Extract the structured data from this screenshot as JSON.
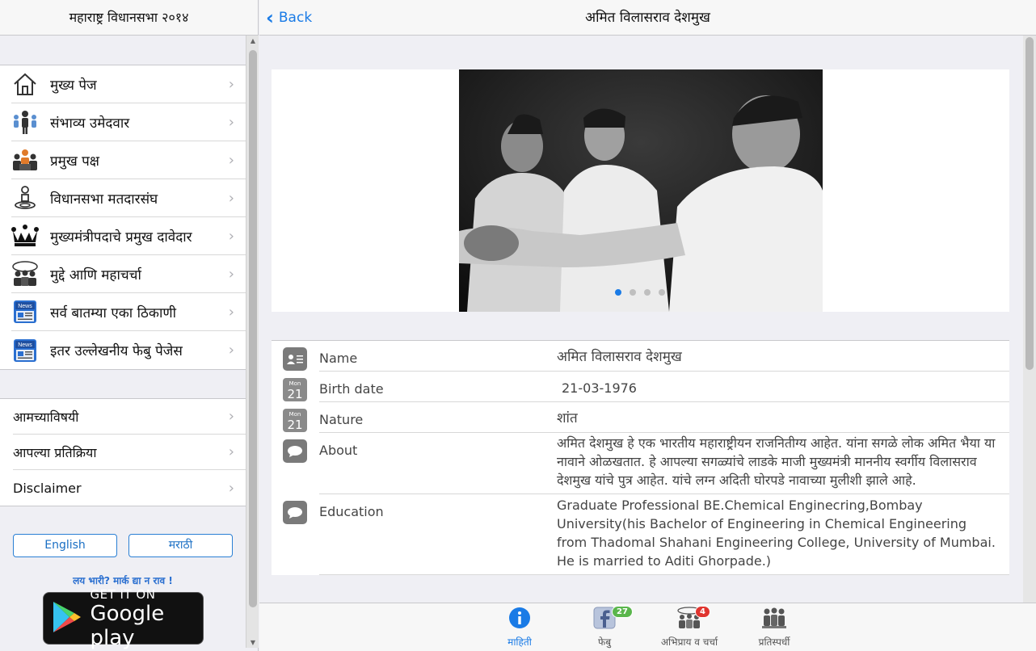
{
  "sidebar": {
    "title": "महाराष्ट्र विधानसभा २०१४",
    "items": [
      {
        "label": "मुख्य पेज",
        "icon": "home-icon"
      },
      {
        "label": "संभाव्य उमेदवार",
        "icon": "candidates-icon"
      },
      {
        "label": "प्रमुख पक्ष",
        "icon": "parties-icon"
      },
      {
        "label": "विधानसभा मतदारसंघ",
        "icon": "constituency-location-icon"
      },
      {
        "label": "मुख्यमंत्रीपदाचे प्रमुख दावेदार",
        "icon": "crown-icon"
      },
      {
        "label": "मुद्दे आणि महाचर्चा",
        "icon": "discussion-icon"
      },
      {
        "label": "सर्व बातम्या एका ठिकाणी",
        "icon": "news-icon"
      },
      {
        "label": "इतर उल्लेखनीय फेबु पेजेस",
        "icon": "news-icon"
      }
    ],
    "items2": [
      {
        "label": "आमच्याविषयी"
      },
      {
        "label": "आपल्या प्रतिक्रिया"
      },
      {
        "label": "Disclaimer"
      }
    ],
    "lang_english": "English",
    "lang_marathi": "मराठी",
    "tagline": "लय भारी? मार्क द्या न राव !",
    "gplay_line1": "GET IT ON",
    "gplay_line2": "Google play"
  },
  "topbar": {
    "back_label": "Back",
    "title": "अमित विलासराव देशमुख"
  },
  "gallery": {
    "total_pages": 4,
    "current_page": 1
  },
  "details": [
    {
      "key": "Name",
      "value": "अमित विलासराव देशमुख",
      "icon": "contact-card-icon"
    },
    {
      "key": "Birth date",
      "value": "21-03-1976",
      "icon": "calendar-icon",
      "cal_month": "Mon",
      "cal_day": "21"
    },
    {
      "key": "Nature",
      "value": "शांत",
      "icon": "calendar-icon",
      "cal_month": "Mon",
      "cal_day": "21"
    },
    {
      "key": "About",
      "value": "अमित देशमुख हे एक भारतीय महाराष्ट्रीयन राजनितीग्य आहेत. यांना सगळे लोक अमित भैया या नावाने ओळखतात. हे आपल्या सगळ्यांचे लाडके माजी मुख्यमंत्री माननीय स्वर्गीय विलासराव देशमुख यांचे पुत्र आहेत. यांचे लग्न अदिती घोरपडे नावाच्या मुलीशी झाले आहे.",
      "icon": "speech-bubble-icon"
    },
    {
      "key": "Education",
      "value": "Graduate Professional BE.Chemical Enginecring,Bombay University(his Bachelor of Engineering in Chemical Engineering from Thadomal Shahani Engineering College, University of Mumbai. He is married to Aditi Ghorpade.)",
      "icon": "speech-bubble-icon"
    }
  ],
  "tabs": [
    {
      "label": "माहिती",
      "icon": "info-icon",
      "active": true
    },
    {
      "label": "फेबु",
      "icon": "facebook-icon",
      "badge": "27"
    },
    {
      "label": "अभिप्राय व चर्चा",
      "icon": "discussion-icon",
      "badge": "4"
    },
    {
      "label": "प्रतिस्पर्धी",
      "icon": "rivals-icon"
    }
  ],
  "colors": {
    "accent": "#1a7be6",
    "badge_red": "#e0342f",
    "badge_green": "#5ab64c"
  }
}
